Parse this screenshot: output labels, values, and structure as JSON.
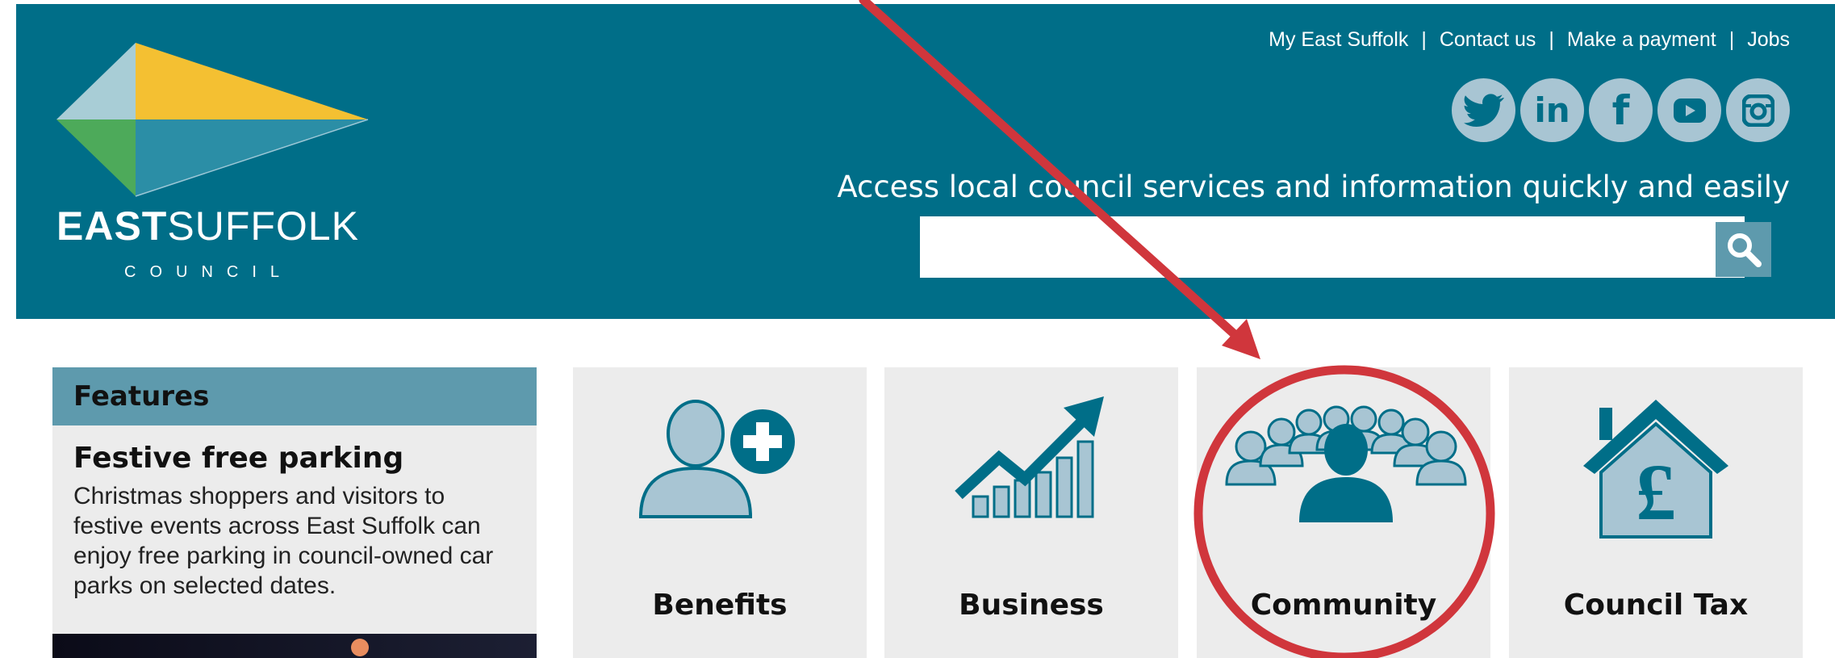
{
  "header": {
    "logo": {
      "word_bold": "EAST",
      "word_light": "SUFFOLK",
      "sub": "COUNCIL"
    },
    "links": [
      "My East Suffolk",
      "Contact us",
      "Make a payment",
      "Jobs"
    ],
    "social": [
      {
        "icon": "twitter-icon",
        "glyph": "t"
      },
      {
        "icon": "linkedin-icon",
        "glyph": "in"
      },
      {
        "icon": "facebook-icon",
        "glyph": "f"
      },
      {
        "icon": "youtube-icon",
        "glyph": "▶"
      },
      {
        "icon": "instagram-icon",
        "glyph": "◎"
      }
    ],
    "tagline": "Access local council services and information quickly and easily",
    "search": {
      "value": "",
      "placeholder": "",
      "button_icon": "search-icon"
    }
  },
  "features": {
    "heading": "Features",
    "title": "Festive free parking",
    "body": "Christmas shoppers and visitors to festive events across East Suffolk can enjoy free parking in council-owned car parks on selected dates."
  },
  "tiles": [
    {
      "label": "Benefits",
      "icon": "person-add-icon"
    },
    {
      "label": "Business",
      "icon": "growth-chart-icon"
    },
    {
      "label": "Community",
      "icon": "community-group-icon"
    },
    {
      "label": "Council Tax",
      "icon": "house-pound-icon"
    }
  ],
  "colors": {
    "header_bg": "#006e88",
    "accent_light": "#5e9aad",
    "icon_light": "#a8c5d3",
    "tile_bg": "#ececec",
    "annotation": "#d0363c",
    "logo_yellow": "#f4c032",
    "logo_green": "#4daa5a",
    "logo_lightblue": "#a8cdd6"
  }
}
